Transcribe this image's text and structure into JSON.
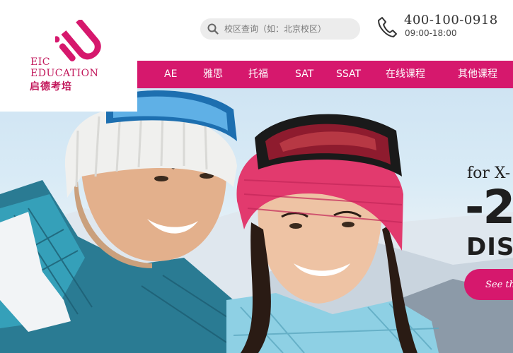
{
  "logo": {
    "line1": "EIC",
    "line2": "EDUCATION",
    "chinese": "启德考培"
  },
  "search": {
    "placeholder": "校区查询（如：北京校区）"
  },
  "contact": {
    "phone": "400-100-0918",
    "hours": "09:00-18:00"
  },
  "nav": {
    "items": [
      {
        "label": "AE"
      },
      {
        "label": "雅思"
      },
      {
        "label": "托福"
      },
      {
        "label": "SAT"
      },
      {
        "label": "SSAT"
      },
      {
        "label": "在线课程"
      },
      {
        "label": "其他课程"
      }
    ]
  },
  "hero": {
    "promo_line1": "for X-",
    "promo_line2": "-2",
    "promo_line3": "DISC",
    "button_label": "See th"
  },
  "colors": {
    "brand": "#d6186d",
    "logo_text": "#c2185b"
  }
}
